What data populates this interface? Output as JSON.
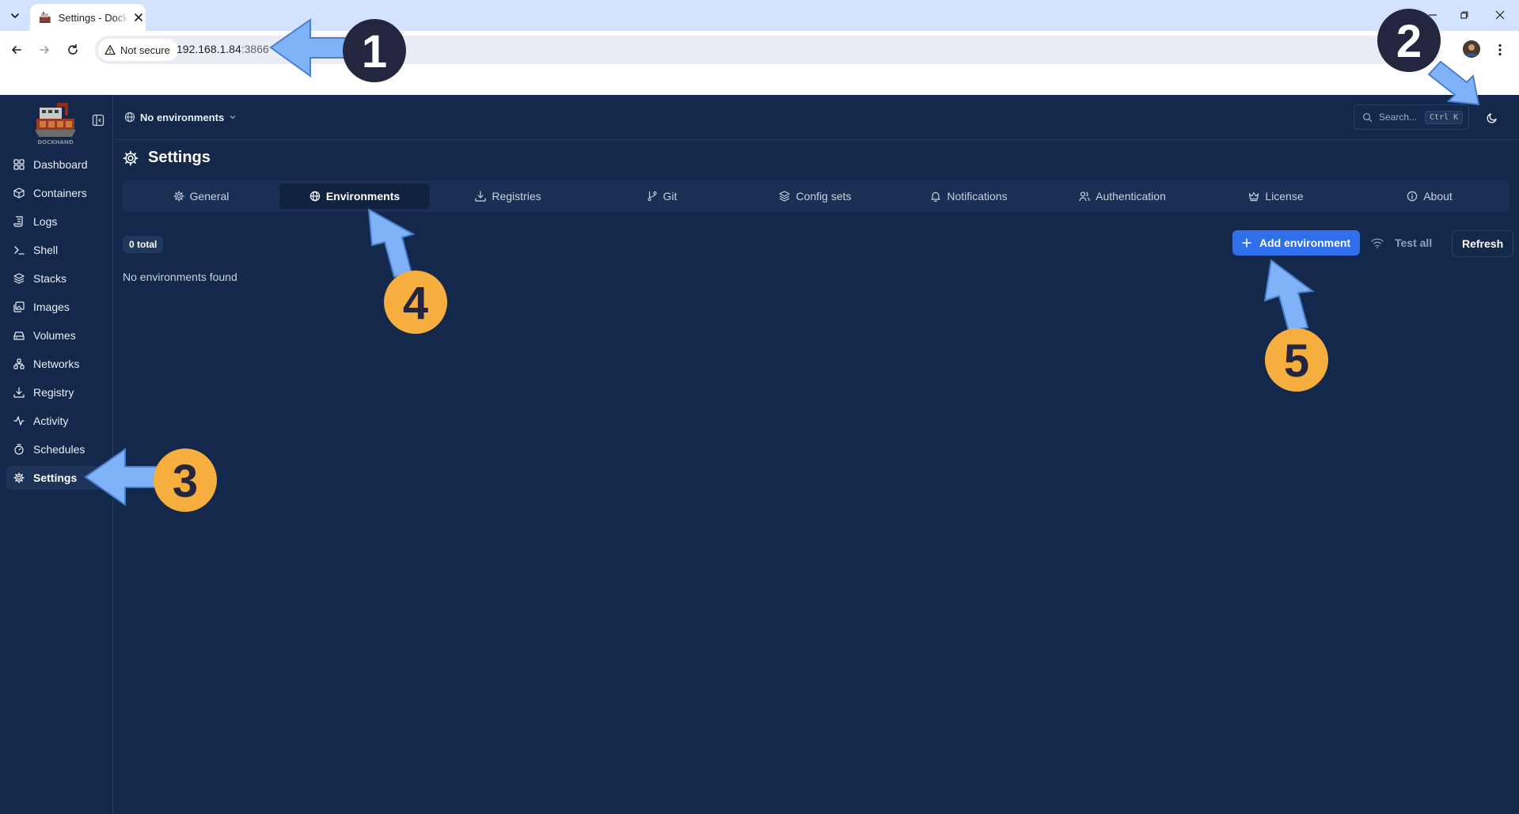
{
  "browser": {
    "tab_title": "Settings - Dockhand",
    "security_label": "Not secure",
    "url_host": "192.168.1.84",
    "url_port": ":3866"
  },
  "app": {
    "logo_text": "DOCKHAND",
    "environment_selector": "No environments",
    "search_placeholder": "Search...",
    "search_shortcut": "Ctrl K",
    "sidebar": {
      "items": [
        {
          "label": "Dashboard",
          "icon": "grid-icon",
          "active": false
        },
        {
          "label": "Containers",
          "icon": "box-icon",
          "active": false
        },
        {
          "label": "Logs",
          "icon": "scroll-icon",
          "active": false
        },
        {
          "label": "Shell",
          "icon": "terminal-icon",
          "active": false
        },
        {
          "label": "Stacks",
          "icon": "layers-icon",
          "active": false
        },
        {
          "label": "Images",
          "icon": "images-icon",
          "active": false
        },
        {
          "label": "Volumes",
          "icon": "hard-drive-icon",
          "active": false
        },
        {
          "label": "Networks",
          "icon": "network-icon",
          "active": false
        },
        {
          "label": "Registry",
          "icon": "download-icon",
          "active": false
        },
        {
          "label": "Activity",
          "icon": "activity-icon",
          "active": false
        },
        {
          "label": "Schedules",
          "icon": "timer-icon",
          "active": false
        },
        {
          "label": "Settings",
          "icon": "gear-icon",
          "active": true
        }
      ]
    },
    "page_title": "Settings",
    "tabs": [
      {
        "label": "General",
        "icon": "gear-icon",
        "active": false
      },
      {
        "label": "Environments",
        "icon": "globe-icon",
        "active": true
      },
      {
        "label": "Registries",
        "icon": "download-icon",
        "active": false
      },
      {
        "label": "Git",
        "icon": "git-branch-icon",
        "active": false
      },
      {
        "label": "Config sets",
        "icon": "layers-icon",
        "active": false
      },
      {
        "label": "Notifications",
        "icon": "bell-icon",
        "active": false
      },
      {
        "label": "Authentication",
        "icon": "users-icon",
        "active": false
      },
      {
        "label": "License",
        "icon": "crown-icon",
        "active": false
      },
      {
        "label": "About",
        "icon": "info-icon",
        "active": false
      }
    ],
    "environments": {
      "total_label": "0 total",
      "empty_message": "No environments found",
      "add_button": "Add environment",
      "test_all_button": "Test all",
      "refresh_button": "Refresh"
    }
  },
  "annotations": {
    "markers": [
      "1",
      "2",
      "3",
      "4",
      "5"
    ],
    "marker_colors": {
      "dark": "#24263f",
      "orange": "#f6ae3e"
    },
    "arrow_color": "#7fb2f6"
  }
}
